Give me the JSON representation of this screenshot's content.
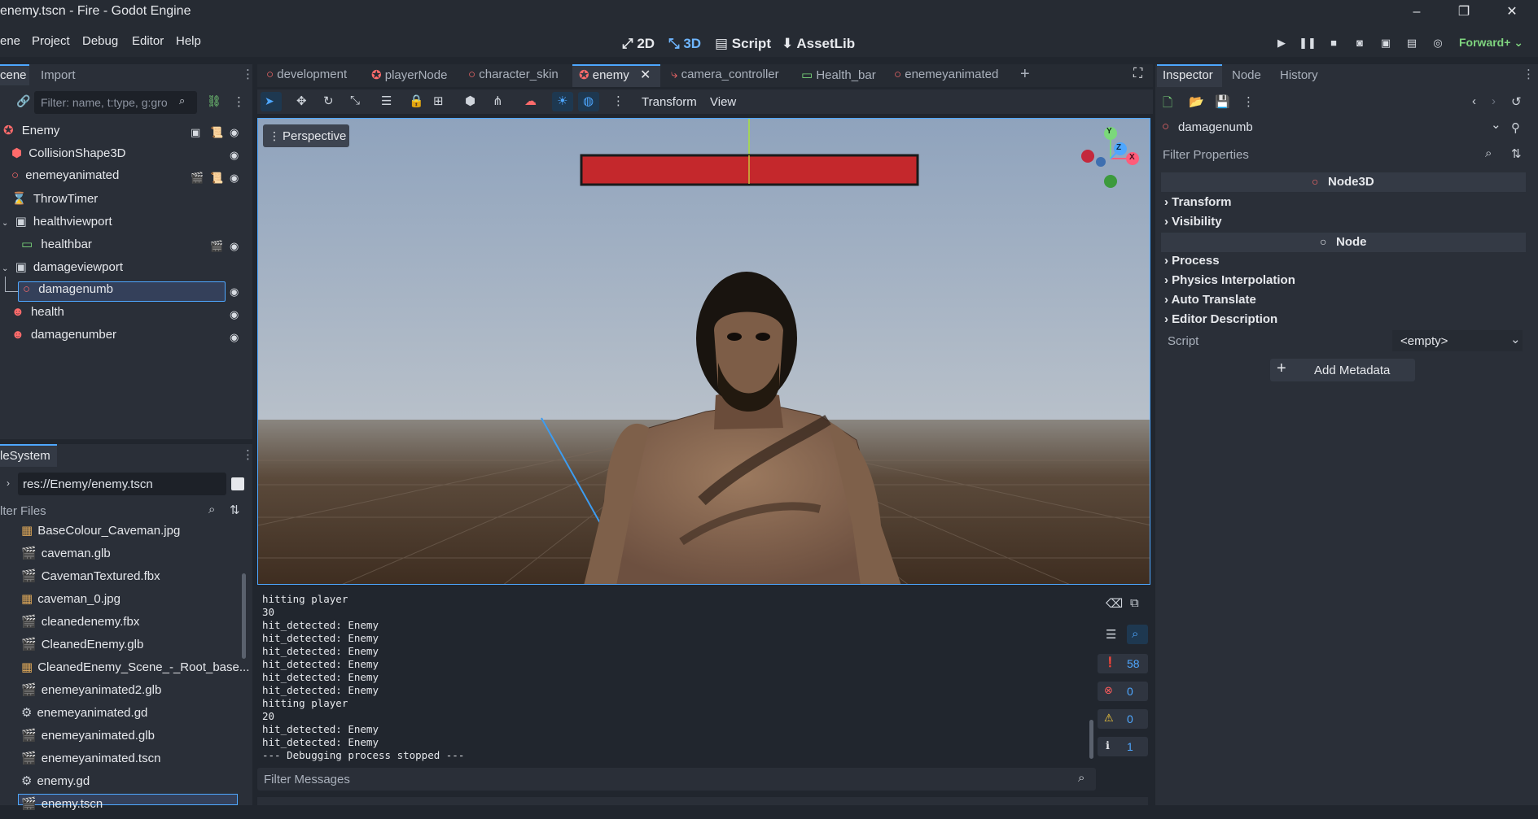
{
  "window": {
    "title": "enemy.tscn - Fire - Godot Engine",
    "controls": [
      "–",
      "❐",
      "✕"
    ]
  },
  "menu": [
    "ene",
    "Project",
    "Debug",
    "Editor",
    "Help"
  ],
  "modes": {
    "m2d": "2D",
    "m3d": "3D",
    "script": "Script",
    "assetlib": "AssetLib"
  },
  "renderer": "Forward+",
  "scene_dock": {
    "tabs": [
      "cene",
      "Import"
    ],
    "filter_placeholder": "Filter: name, t:type, g:gro",
    "nodes": [
      {
        "label": "Enemy",
        "icon": "◆"
      },
      {
        "label": "CollisionShape3D",
        "icon": "⬢"
      },
      {
        "label": "enemeyanimated",
        "icon": "○"
      },
      {
        "label": "ThrowTimer",
        "icon": "⌛"
      },
      {
        "label": "healthviewport",
        "icon": "▣"
      },
      {
        "label": "healthbar",
        "icon": "▭"
      },
      {
        "label": "damageviewport",
        "icon": "▣"
      },
      {
        "label": "damagenumb",
        "icon": "○"
      },
      {
        "label": "health",
        "icon": "☻"
      },
      {
        "label": "damagenumber",
        "icon": "☻"
      }
    ]
  },
  "filesystem": {
    "tab": "leSystem",
    "path": "res://Enemy/enemy.tscn",
    "filter_placeholder": "lter Files",
    "files": [
      "BaseColour_Caveman.jpg",
      "caveman.glb",
      "CavemanTextured.fbx",
      "caveman_0.jpg",
      "cleanedenemy.fbx",
      "CleanedEnemy.glb",
      "CleanedEnemy_Scene_-_Root_base...",
      "enemeyanimated2.glb",
      "enemeyanimated.gd",
      "enemeyanimated.glb",
      "enemeyanimated.tscn",
      "enemy.gd",
      "enemy.tscn"
    ]
  },
  "scene_tabs": [
    "development",
    "playerNode",
    "character_skin",
    "enemy",
    "camera_controller",
    "Health_bar",
    "enemeyanimated"
  ],
  "viewport_toolbar": {
    "transform": "Transform",
    "view": "View"
  },
  "viewport": {
    "perspective": "Perspective",
    "gizmo": {
      "y": "Y",
      "z": "Z",
      "x": "X"
    }
  },
  "console": {
    "lines": [
      "hitting player",
      "30",
      "hit_detected: Enemy",
      "hit_detected: Enemy",
      "hit_detected: Enemy",
      "hit_detected: Enemy",
      "hit_detected: Enemy",
      "hit_detected: Enemy",
      "hitting player",
      "20",
      "hit_detected: Enemy",
      "hit_detected: Enemy",
      "--- Debugging process stopped ---"
    ],
    "filter_placeholder": "Filter Messages",
    "counts": {
      "messages": "58",
      "errors": "0",
      "warnings": "0",
      "info": "1"
    }
  },
  "inspector": {
    "tabs": [
      "Inspector",
      "Node",
      "History"
    ],
    "node_name": "damagenumb",
    "filter_placeholder": "Filter Properties",
    "class_node3d": "Node3D",
    "class_node": "Node",
    "sections": [
      "Transform",
      "Visibility",
      "Process",
      "Physics Interpolation",
      "Auto Translate",
      "Editor Description"
    ],
    "script_label": "Script",
    "script_value": "<empty>",
    "add_metadata": "Add Metadata"
  },
  "colors": {
    "accent": "#4ea7ff",
    "health_bar": "#c4282c"
  }
}
